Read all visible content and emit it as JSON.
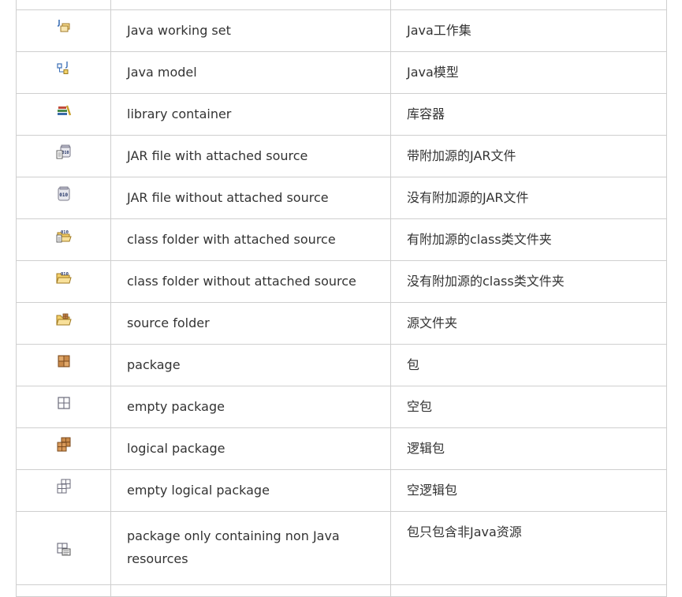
{
  "rows": [
    {
      "icon": "java-working-set-icon",
      "en": "Java working set",
      "zh": "Java工作集"
    },
    {
      "icon": "java-model-icon",
      "en": "Java model",
      "zh": "Java模型"
    },
    {
      "icon": "library-container-icon",
      "en": "library container",
      "zh": "库容器"
    },
    {
      "icon": "jar-with-source-icon",
      "en": "JAR file with attached source",
      "zh": "带附加源的JAR文件"
    },
    {
      "icon": "jar-without-source-icon",
      "en": "JAR file without attached source",
      "zh": "没有附加源的JAR文件"
    },
    {
      "icon": "class-folder-with-source-icon",
      "en": "class folder with attached source",
      "zh": "有附加源的class类文件夹"
    },
    {
      "icon": "class-folder-without-source-icon",
      "en": "class folder without attached source",
      "zh": "没有附加源的class类文件夹"
    },
    {
      "icon": "source-folder-icon",
      "en": "source folder",
      "zh": "源文件夹"
    },
    {
      "icon": "package-icon",
      "en": "package",
      "zh": "包"
    },
    {
      "icon": "empty-package-icon",
      "en": "empty package",
      "zh": "空包"
    },
    {
      "icon": "logical-package-icon",
      "en": "logical package",
      "zh": "逻辑包"
    },
    {
      "icon": "empty-logical-package-icon",
      "en": "empty logical package",
      "zh": "空逻辑包"
    },
    {
      "icon": "non-java-resources-package-icon",
      "en": "package only containing non Java resources",
      "zh": "包只包含非Java资源"
    }
  ]
}
